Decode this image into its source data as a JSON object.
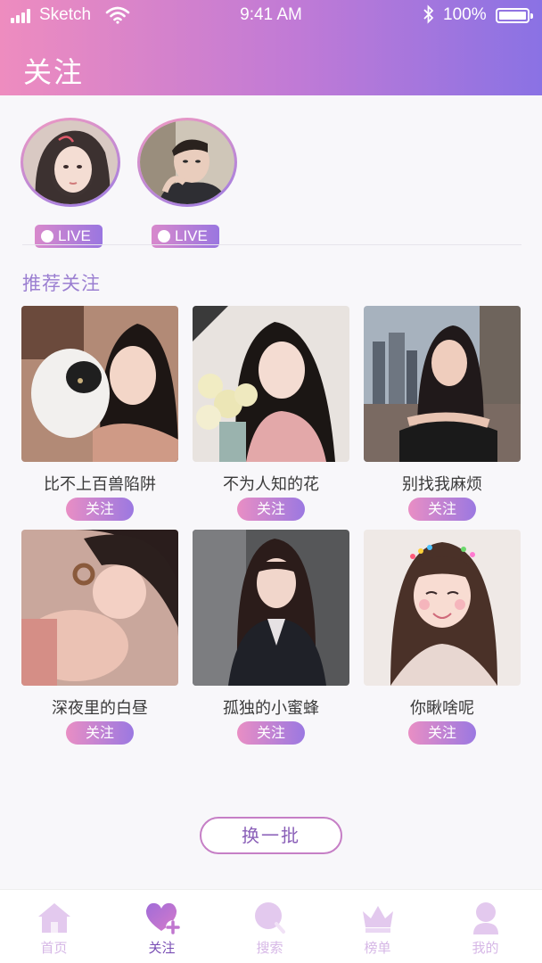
{
  "status_bar": {
    "carrier": "Sketch",
    "time": "9:41 AM",
    "battery": "100%",
    "battery_level": 1.0
  },
  "header": {
    "title": "关注"
  },
  "live": {
    "badge_label": "LIVE",
    "users": [
      {
        "avatar": "live-avatar-1"
      },
      {
        "avatar": "live-avatar-2"
      }
    ]
  },
  "recommend": {
    "title": "推荐关注",
    "follow_label": "关注",
    "users": [
      {
        "name": "比不上百兽陷阱"
      },
      {
        "name": "不为人知的花"
      },
      {
        "name": "别找我麻烦"
      },
      {
        "name": "深夜里的白昼"
      },
      {
        "name": "孤独的小蜜蜂"
      },
      {
        "name": "你瞅啥呢"
      }
    ]
  },
  "refresh_label": "换一批",
  "tabbar": {
    "items": [
      {
        "label": "首页",
        "icon": "home-icon"
      },
      {
        "label": "关注",
        "icon": "heart-plus-icon",
        "active": true
      },
      {
        "label": "搜索",
        "icon": "search-icon"
      },
      {
        "label": "榜单",
        "icon": "crown-icon"
      },
      {
        "label": "我的",
        "icon": "user-icon"
      }
    ]
  },
  "colors": {
    "header_gradient_start": "#ee8cbf",
    "header_gradient_end": "#8a72e4",
    "accent": "#9b7fd1",
    "tab_active": "#7a4fb5",
    "tab_inactive": "#d6b7e6"
  }
}
